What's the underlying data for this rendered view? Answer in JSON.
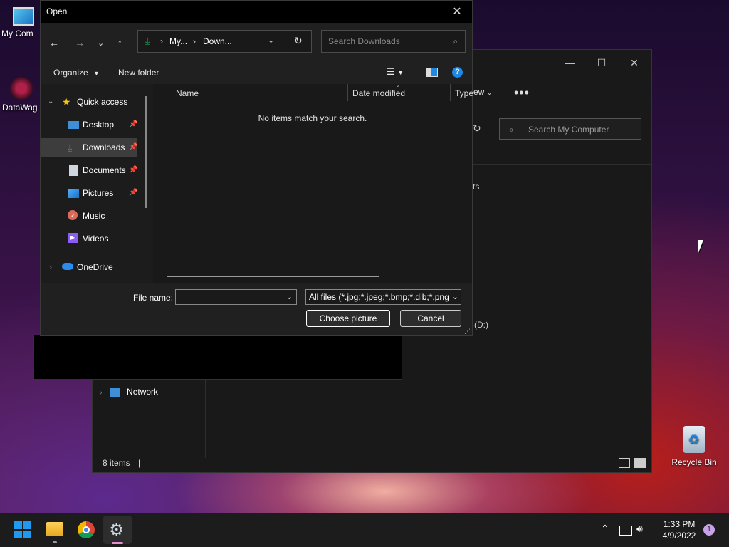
{
  "desktop": {
    "icons": [
      {
        "label": "My Com"
      },
      {
        "label": "DataWag"
      },
      {
        "label": "Recycle Bin"
      }
    ]
  },
  "explorer": {
    "search_placeholder": "Search My Computer",
    "partial_text_1": "ts",
    "partial_text_2": "(D:)",
    "sidebar_network": "Network",
    "status_items": "8 items"
  },
  "dialog": {
    "title": "Open",
    "breadcrumb": [
      "My...",
      "Down..."
    ],
    "search_placeholder": "Search Downloads",
    "toolbar": {
      "organize": "Organize",
      "new_folder": "New folder"
    },
    "sidebar": {
      "quick_access": "Quick access",
      "items": [
        {
          "label": "Desktop",
          "pinned": true
        },
        {
          "label": "Downloads",
          "pinned": true
        },
        {
          "label": "Documents",
          "pinned": true
        },
        {
          "label": "Pictures",
          "pinned": true
        },
        {
          "label": "Music",
          "pinned": false
        },
        {
          "label": "Videos",
          "pinned": false
        }
      ],
      "onedrive": "OneDrive"
    },
    "columns": {
      "name": "Name",
      "date_modified": "Date modified",
      "type": "Type"
    },
    "behind_view": "ew",
    "empty_message": "No items match your search.",
    "file_name_label": "File name:",
    "file_name_value": "",
    "file_type_value": "All files (*.jpg;*.jpeg;*.bmp;*.dib;*.png",
    "choose_button": "Choose picture",
    "cancel_button": "Cancel"
  },
  "taskbar": {
    "time": "1:33 PM",
    "date": "4/9/2022",
    "notification_count": "1"
  },
  "colors": {
    "accent_blue": "#1e88e5",
    "download_green": "#2eb872",
    "star_yellow": "#f2c21b"
  }
}
